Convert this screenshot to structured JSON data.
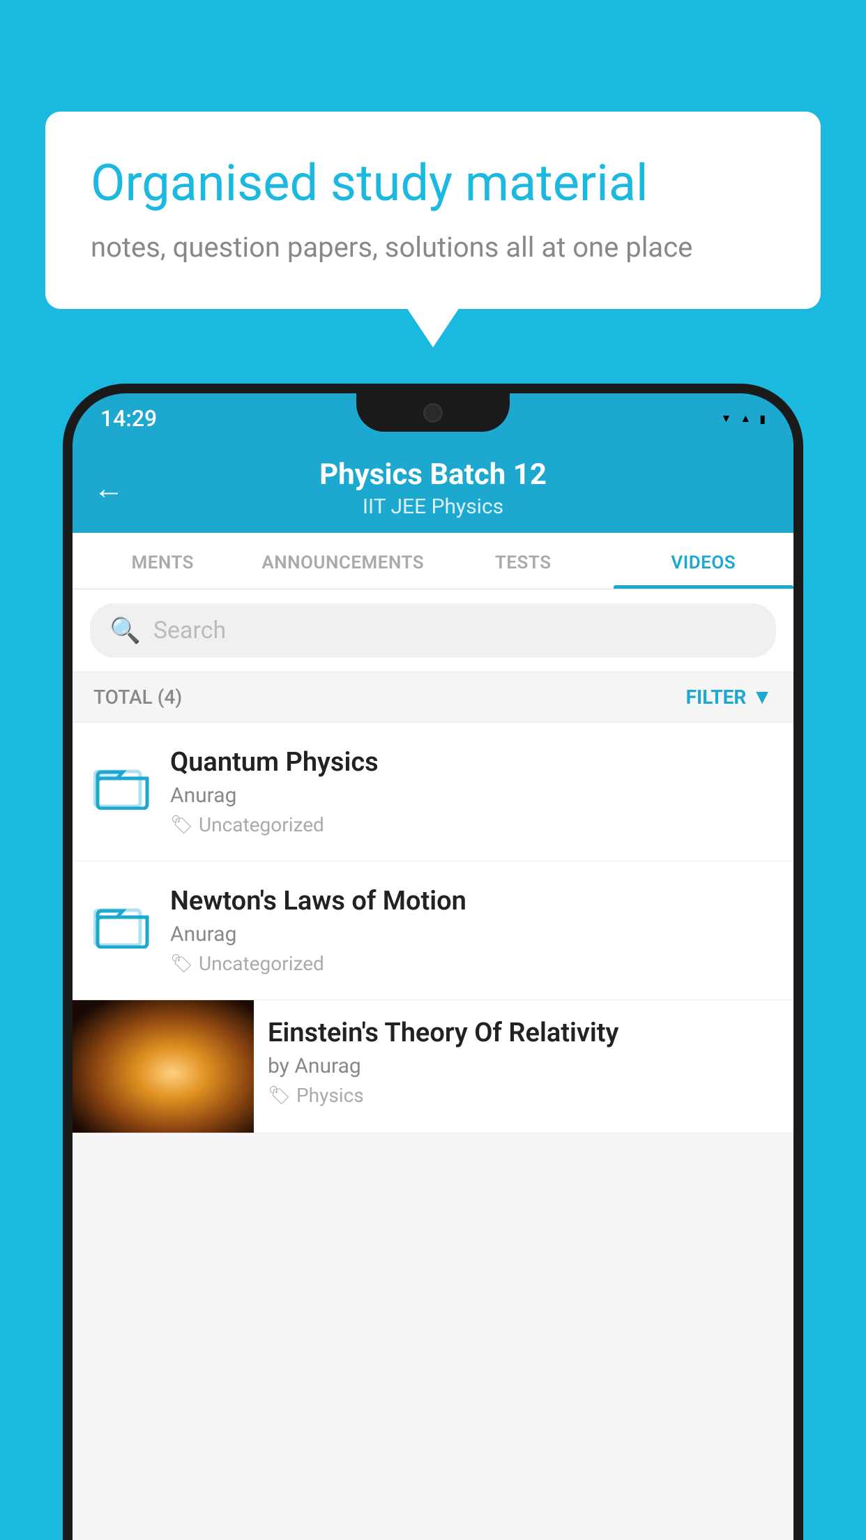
{
  "background": {
    "color": "#1bb8e0"
  },
  "speech_bubble": {
    "title": "Organised study material",
    "subtitle": "notes, question papers, solutions all at one place"
  },
  "phone": {
    "status_bar": {
      "time": "14:29",
      "wifi": "▾",
      "signal": "▴",
      "battery": "▮"
    },
    "header": {
      "back_label": "←",
      "title": "Physics Batch 12",
      "subtitle": "IIT JEE   Physics"
    },
    "tabs": [
      {
        "label": "MENTS",
        "active": false
      },
      {
        "label": "ANNOUNCEMENTS",
        "active": false
      },
      {
        "label": "TESTS",
        "active": false
      },
      {
        "label": "VIDEOS",
        "active": true
      }
    ],
    "search": {
      "placeholder": "Search"
    },
    "filter_row": {
      "total_label": "TOTAL (4)",
      "filter_label": "FILTER"
    },
    "videos": [
      {
        "title": "Quantum Physics",
        "author": "Anurag",
        "tag": "Uncategorized",
        "type": "folder"
      },
      {
        "title": "Newton's Laws of Motion",
        "author": "Anurag",
        "tag": "Uncategorized",
        "type": "folder"
      },
      {
        "title": "Einstein's Theory Of Relativity",
        "author": "by Anurag",
        "tag": "Physics",
        "type": "video"
      }
    ]
  }
}
